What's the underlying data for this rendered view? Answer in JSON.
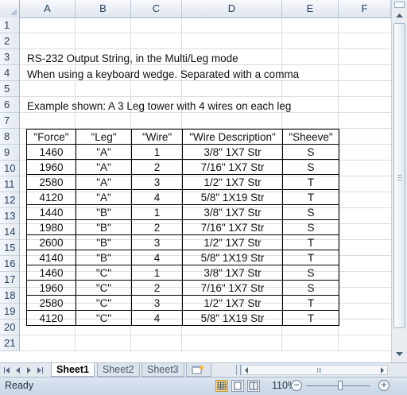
{
  "columns": [
    "A",
    "B",
    "C",
    "D",
    "E",
    "F"
  ],
  "rows": [
    "1",
    "2",
    "3",
    "4",
    "5",
    "6",
    "7",
    "8",
    "9",
    "10",
    "11",
    "12",
    "13",
    "14",
    "15",
    "16",
    "17",
    "18",
    "19",
    "20",
    "21"
  ],
  "notes": {
    "r3": "RS-232 Output String, in the Multi/Leg mode",
    "r4": "When using a keyboard wedge. Separated with a comma",
    "r6": "Example shown:  A 3 Leg tower with 4 wires on each leg"
  },
  "table": {
    "headers": [
      "\"Force\"",
      "\"Leg\"",
      "\"Wire\"",
      "\"Wire Description\"",
      "\"Sheeve\""
    ],
    "rows": [
      [
        "1460",
        "\"A\"",
        "1",
        "3/8\" 1X7 Str",
        "S"
      ],
      [
        "1960",
        "\"A\"",
        "2",
        "7/16\" 1X7 Str",
        "S"
      ],
      [
        "2580",
        "\"A\"",
        "3",
        "1/2\" 1X7 Str",
        "T"
      ],
      [
        "4120",
        "\"A\"",
        "4",
        "5/8\" 1X19 Str",
        "T"
      ],
      [
        "1440",
        "\"B\"",
        "1",
        "3/8\" 1X7 Str",
        "S"
      ],
      [
        "1980",
        "\"B\"",
        "2",
        "7/16\" 1X7 Str",
        "S"
      ],
      [
        "2600",
        "\"B\"",
        "3",
        "1/2\" 1X7 Str",
        "T"
      ],
      [
        "4140",
        "\"B\"",
        "4",
        "5/8\" 1X19 Str",
        "T"
      ],
      [
        "1460",
        "\"C\"",
        "1",
        "3/8\" 1X7 Str",
        "S"
      ],
      [
        "1960",
        "\"C\"",
        "2",
        "7/16\" 1X7 Str",
        "S"
      ],
      [
        "2580",
        "\"C\"",
        "3",
        "1/2\" 1X7 Str",
        "T"
      ],
      [
        "4120",
        "\"C\"",
        "4",
        "5/8\" 1X19 Str",
        "T"
      ]
    ]
  },
  "sheets": [
    "Sheet1",
    "Sheet2",
    "Sheet3"
  ],
  "active_sheet": "Sheet1",
  "status": {
    "ready": "Ready",
    "zoom": "110%"
  },
  "icons": {
    "nav": [
      "first-sheet-icon",
      "prev-sheet-icon",
      "next-sheet-icon",
      "last-sheet-icon"
    ],
    "insert_sheet": "insert-sheet-icon"
  }
}
